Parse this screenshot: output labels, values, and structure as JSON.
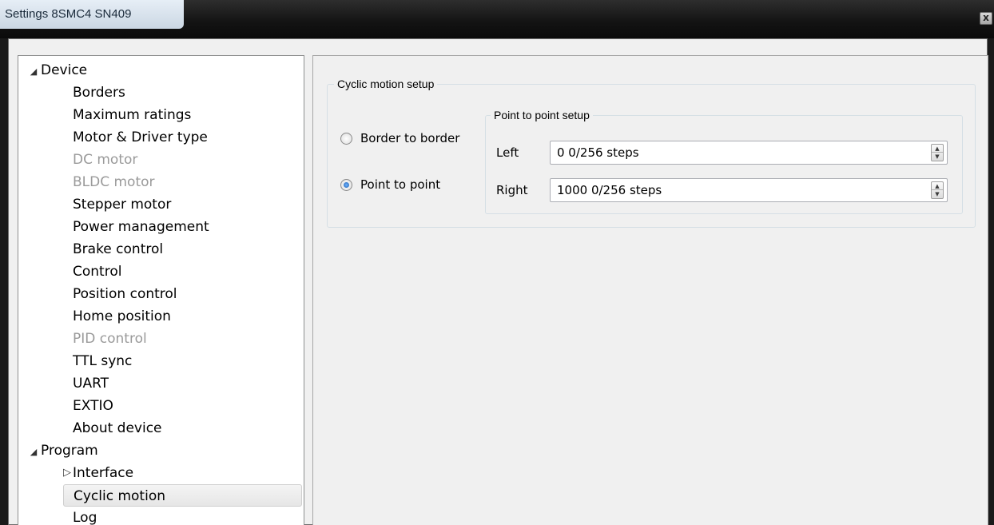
{
  "window": {
    "title": "Settings 8SMC4 SN409",
    "close_label": "x"
  },
  "tree": {
    "device": {
      "label": "Device",
      "expander": "◢",
      "items": [
        {
          "label": "Borders",
          "enabled": true
        },
        {
          "label": "Maximum ratings",
          "enabled": true
        },
        {
          "label": "Motor & Driver type",
          "enabled": true
        },
        {
          "label": "DC motor",
          "enabled": false
        },
        {
          "label": "BLDC motor",
          "enabled": false
        },
        {
          "label": "Stepper motor",
          "enabled": true
        },
        {
          "label": "Power management",
          "enabled": true
        },
        {
          "label": "Brake control",
          "enabled": true
        },
        {
          "label": "Control",
          "enabled": true
        },
        {
          "label": "Position control",
          "enabled": true
        },
        {
          "label": "Home position",
          "enabled": true
        },
        {
          "label": "PID control",
          "enabled": false
        },
        {
          "label": "TTL sync",
          "enabled": true
        },
        {
          "label": "UART",
          "enabled": true
        },
        {
          "label": "EXTIO",
          "enabled": true
        },
        {
          "label": "About device",
          "enabled": true
        }
      ]
    },
    "program": {
      "label": "Program",
      "expander": "◢",
      "items": [
        {
          "label": "Interface",
          "expander": "▷"
        },
        {
          "label": "Cyclic motion",
          "selected": true
        },
        {
          "label": "Log"
        }
      ]
    }
  },
  "cyclic": {
    "group_title": "Cyclic motion setup",
    "radio_border": "Border to border",
    "radio_point": "Point to point",
    "selected": "Point to point",
    "p2p": {
      "group_title": "Point to point setup",
      "left_label": "Left",
      "left_value": "0 0/256 steps",
      "right_label": "Right",
      "right_value": "1000 0/256 steps"
    }
  },
  "icons": {
    "spin_up": "▲",
    "spin_down": "▼"
  }
}
